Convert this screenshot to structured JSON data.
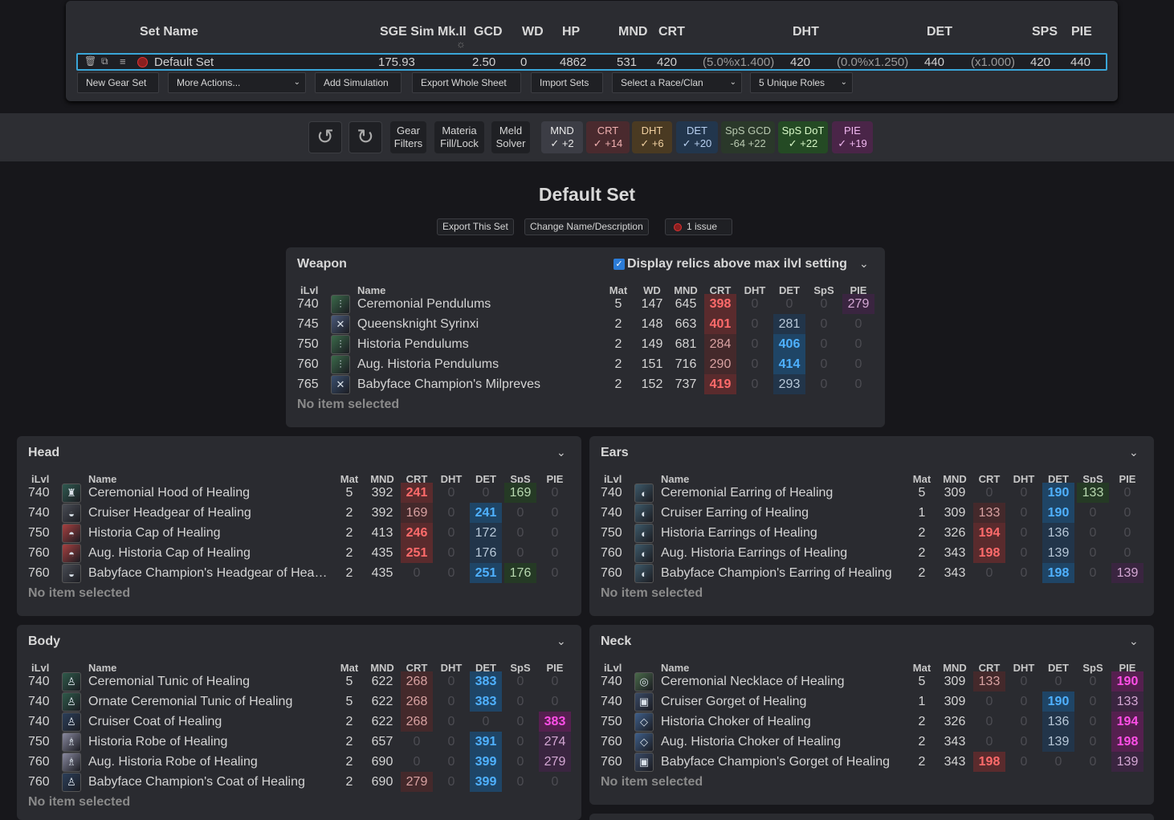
{
  "sets": {
    "headers": [
      "Set Name",
      "SGE Sim Mk.II",
      "GCD",
      "WD",
      "HP",
      "MND",
      "CRT",
      "DHT",
      "DET",
      "SPS",
      "PIE"
    ],
    "row": {
      "name": "Default Set",
      "sim": "175.93",
      "gcd": "2.50",
      "wd": "0",
      "hp": "4862",
      "mnd": "531",
      "crt": "420",
      "crt_mult": "(5.0%x1.400)",
      "dht": "420",
      "dht_mult": "(0.0%x1.250)",
      "det": "440",
      "det_mult": "(x1.000)",
      "sps": "420",
      "pie": "440"
    },
    "buttons": {
      "new": "New Gear Set",
      "more": "More Actions...",
      "addsim": "Add Simulation",
      "export": "Export Whole Sheet",
      "import": "Import Sets",
      "race": "Select a Race/Clan",
      "roles": "5 Unique Roles"
    }
  },
  "toolbar": {
    "gear_filters": [
      "Gear",
      "Filters"
    ],
    "materia": [
      "Materia",
      "Fill/Lock"
    ],
    "meld": [
      "Meld",
      "Solver"
    ],
    "subs": [
      {
        "name": "MND",
        "val": "✓ +2"
      },
      {
        "name": "CRT",
        "val": "✓ +14"
      },
      {
        "name": "DHT",
        "val": "✓ +6"
      },
      {
        "name": "DET",
        "val": "✓ +20"
      },
      {
        "name": "SpS GCD",
        "val": "-64  +22"
      },
      {
        "name": "SpS DoT",
        "val": "✓ +22"
      },
      {
        "name": "PIE",
        "val": "✓ +19"
      }
    ]
  },
  "set_title": "Default Set",
  "set_buttons": {
    "export": "Export This Set",
    "change": "Change Name/Description",
    "issues": "1 issue"
  },
  "columns": [
    "iLvl",
    "Name",
    "Mat",
    "WD",
    "MND",
    "CRT",
    "DHT",
    "DET",
    "SpS",
    "PIE"
  ],
  "panels": [
    {
      "title": "Weapon",
      "checkbox_label": "Display relics above max ilvl setting",
      "no_item": "No item selected",
      "has_wd": true,
      "items": [
        {
          "ilvl": "740",
          "name": "Ceremonial Pendulums",
          "mat": "5",
          "wd": "147",
          "mnd": "645",
          "crt": "398",
          "dht": "0",
          "det": "0",
          "sps": "0",
          "pie": "279",
          "icon": "pendulum-icon",
          "hl": {
            "crt": "hi",
            "pie": "md"
          }
        },
        {
          "ilvl": "745",
          "name": "Queensknight Syrinxi",
          "mat": "2",
          "wd": "148",
          "mnd": "663",
          "crt": "401",
          "dht": "0",
          "det": "281",
          "sps": "0",
          "pie": "0",
          "icon": "syrinx-icon",
          "hl": {
            "crt": "hi",
            "det": "md"
          }
        },
        {
          "ilvl": "750",
          "name": "Historia Pendulums",
          "mat": "2",
          "wd": "149",
          "mnd": "681",
          "crt": "284",
          "dht": "0",
          "det": "406",
          "sps": "0",
          "pie": "0",
          "icon": "pendulum-icon",
          "hl": {
            "crt": "md",
            "det": "hi"
          }
        },
        {
          "ilvl": "760",
          "name": "Aug. Historia Pendulums",
          "mat": "2",
          "wd": "151",
          "mnd": "716",
          "crt": "290",
          "dht": "0",
          "det": "414",
          "sps": "0",
          "pie": "0",
          "icon": "pendulum-icon",
          "hl": {
            "crt": "md",
            "det": "hi"
          }
        },
        {
          "ilvl": "765",
          "name": "Babyface Champion's Milpreves",
          "mat": "2",
          "wd": "152",
          "mnd": "737",
          "crt": "419",
          "dht": "0",
          "det": "293",
          "sps": "0",
          "pie": "0",
          "icon": "milpreves-icon",
          "hl": {
            "crt": "hi",
            "det": "md"
          }
        }
      ]
    },
    {
      "title": "Head",
      "no_item": "No item selected",
      "has_wd": false,
      "items": [
        {
          "ilvl": "740",
          "name": "Ceremonial Hood of Healing",
          "mat": "5",
          "mnd": "392",
          "crt": "241",
          "dht": "0",
          "det": "0",
          "sps": "169",
          "pie": "0",
          "icon": "hood-icon",
          "hl": {
            "crt": "hi",
            "sps": "md"
          }
        },
        {
          "ilvl": "740",
          "name": "Cruiser Headgear of Healing",
          "mat": "2",
          "mnd": "392",
          "crt": "169",
          "dht": "0",
          "det": "241",
          "sps": "0",
          "pie": "0",
          "icon": "headgear-icon",
          "hl": {
            "crt": "md",
            "det": "hi"
          }
        },
        {
          "ilvl": "750",
          "name": "Historia Cap of Healing",
          "mat": "2",
          "mnd": "413",
          "crt": "246",
          "dht": "0",
          "det": "172",
          "sps": "0",
          "pie": "0",
          "icon": "cap-icon",
          "hl": {
            "crt": "hi",
            "det": "md"
          }
        },
        {
          "ilvl": "760",
          "name": "Aug. Historia Cap of Healing",
          "mat": "2",
          "mnd": "435",
          "crt": "251",
          "dht": "0",
          "det": "176",
          "sps": "0",
          "pie": "0",
          "icon": "cap-icon",
          "hl": {
            "crt": "hi",
            "det": "md"
          }
        },
        {
          "ilvl": "760",
          "name": "Babyface Champion's Headgear of Hea…",
          "mat": "2",
          "mnd": "435",
          "crt": "0",
          "dht": "0",
          "det": "251",
          "sps": "176",
          "pie": "0",
          "icon": "headgear-icon",
          "hl": {
            "det": "hi",
            "sps": "md"
          }
        }
      ]
    },
    {
      "title": "Ears",
      "no_item": "No item selected",
      "has_wd": false,
      "items": [
        {
          "ilvl": "740",
          "name": "Ceremonial Earring of Healing",
          "mat": "5",
          "mnd": "309",
          "crt": "0",
          "dht": "0",
          "det": "190",
          "sps": "133",
          "pie": "0",
          "icon": "earring-icon",
          "hl": {
            "det": "hi",
            "sps": "md"
          }
        },
        {
          "ilvl": "740",
          "name": "Cruiser Earring of Healing",
          "mat": "1",
          "mnd": "309",
          "crt": "133",
          "dht": "0",
          "det": "190",
          "sps": "0",
          "pie": "0",
          "icon": "earring-icon",
          "hl": {
            "crt": "md",
            "det": "hi"
          }
        },
        {
          "ilvl": "750",
          "name": "Historia Earrings of Healing",
          "mat": "2",
          "mnd": "326",
          "crt": "194",
          "dht": "0",
          "det": "136",
          "sps": "0",
          "pie": "0",
          "icon": "earring-icon",
          "hl": {
            "crt": "hi",
            "det": "md"
          }
        },
        {
          "ilvl": "760",
          "name": "Aug. Historia Earrings of Healing",
          "mat": "2",
          "mnd": "343",
          "crt": "198",
          "dht": "0",
          "det": "139",
          "sps": "0",
          "pie": "0",
          "icon": "earring-icon",
          "hl": {
            "crt": "hi",
            "det": "md"
          }
        },
        {
          "ilvl": "760",
          "name": "Babyface Champion's Earring of Healing",
          "mat": "2",
          "mnd": "343",
          "crt": "0",
          "dht": "0",
          "det": "198",
          "sps": "0",
          "pie": "139",
          "icon": "earring-icon",
          "hl": {
            "det": "hi",
            "pie": "md"
          }
        }
      ]
    },
    {
      "title": "Body",
      "no_item": "No item selected",
      "has_wd": false,
      "items": [
        {
          "ilvl": "740",
          "name": "Ceremonial Tunic of Healing",
          "mat": "5",
          "mnd": "622",
          "crt": "268",
          "dht": "0",
          "det": "383",
          "sps": "0",
          "pie": "0",
          "icon": "tunic-icon",
          "hl": {
            "crt": "md",
            "det": "hi"
          }
        },
        {
          "ilvl": "740",
          "name": "Ornate Ceremonial Tunic of Healing",
          "mat": "5",
          "mnd": "622",
          "crt": "268",
          "dht": "0",
          "det": "383",
          "sps": "0",
          "pie": "0",
          "icon": "tunic-icon",
          "hl": {
            "crt": "md",
            "det": "hi"
          }
        },
        {
          "ilvl": "740",
          "name": "Cruiser Coat of Healing",
          "mat": "2",
          "mnd": "622",
          "crt": "268",
          "dht": "0",
          "det": "0",
          "sps": "0",
          "pie": "383",
          "icon": "coat-icon",
          "hl": {
            "crt": "md",
            "pie": "hi"
          }
        },
        {
          "ilvl": "750",
          "name": "Historia Robe of Healing",
          "mat": "2",
          "mnd": "657",
          "crt": "0",
          "dht": "0",
          "det": "391",
          "sps": "0",
          "pie": "274",
          "icon": "robe-icon",
          "hl": {
            "det": "hi",
            "pie": "md"
          }
        },
        {
          "ilvl": "760",
          "name": "Aug. Historia Robe of Healing",
          "mat": "2",
          "mnd": "690",
          "crt": "0",
          "dht": "0",
          "det": "399",
          "sps": "0",
          "pie": "279",
          "icon": "robe-icon",
          "hl": {
            "det": "hi",
            "pie": "md"
          }
        },
        {
          "ilvl": "760",
          "name": "Babyface Champion's Coat of Healing",
          "mat": "2",
          "mnd": "690",
          "crt": "279",
          "dht": "0",
          "det": "399",
          "sps": "0",
          "pie": "0",
          "icon": "coat-icon",
          "hl": {
            "crt": "md",
            "det": "hi"
          }
        }
      ]
    },
    {
      "title": "Neck",
      "no_item": "No item selected",
      "has_wd": false,
      "items": [
        {
          "ilvl": "740",
          "name": "Ceremonial Necklace of Healing",
          "mat": "5",
          "mnd": "309",
          "crt": "133",
          "dht": "0",
          "det": "0",
          "sps": "0",
          "pie": "190",
          "icon": "necklace-icon",
          "hl": {
            "crt": "md",
            "pie": "hi"
          }
        },
        {
          "ilvl": "740",
          "name": "Cruiser Gorget of Healing",
          "mat": "1",
          "mnd": "309",
          "crt": "0",
          "dht": "0",
          "det": "190",
          "sps": "0",
          "pie": "133",
          "icon": "gorget-icon",
          "hl": {
            "det": "hi",
            "pie": "md"
          }
        },
        {
          "ilvl": "750",
          "name": "Historia Choker of Healing",
          "mat": "2",
          "mnd": "326",
          "crt": "0",
          "dht": "0",
          "det": "136",
          "sps": "0",
          "pie": "194",
          "icon": "choker-icon",
          "hl": {
            "det": "md",
            "pie": "hi"
          }
        },
        {
          "ilvl": "760",
          "name": "Aug. Historia Choker of Healing",
          "mat": "2",
          "mnd": "343",
          "crt": "0",
          "dht": "0",
          "det": "139",
          "sps": "0",
          "pie": "198",
          "icon": "choker-icon",
          "hl": {
            "det": "md",
            "pie": "hi"
          }
        },
        {
          "ilvl": "760",
          "name": "Babyface Champion's Gorget of Healing",
          "mat": "2",
          "mnd": "343",
          "crt": "198",
          "dht": "0",
          "det": "0",
          "sps": "0",
          "pie": "139",
          "icon": "gorget-icon",
          "hl": {
            "crt": "hi",
            "pie": "md"
          }
        }
      ]
    }
  ]
}
